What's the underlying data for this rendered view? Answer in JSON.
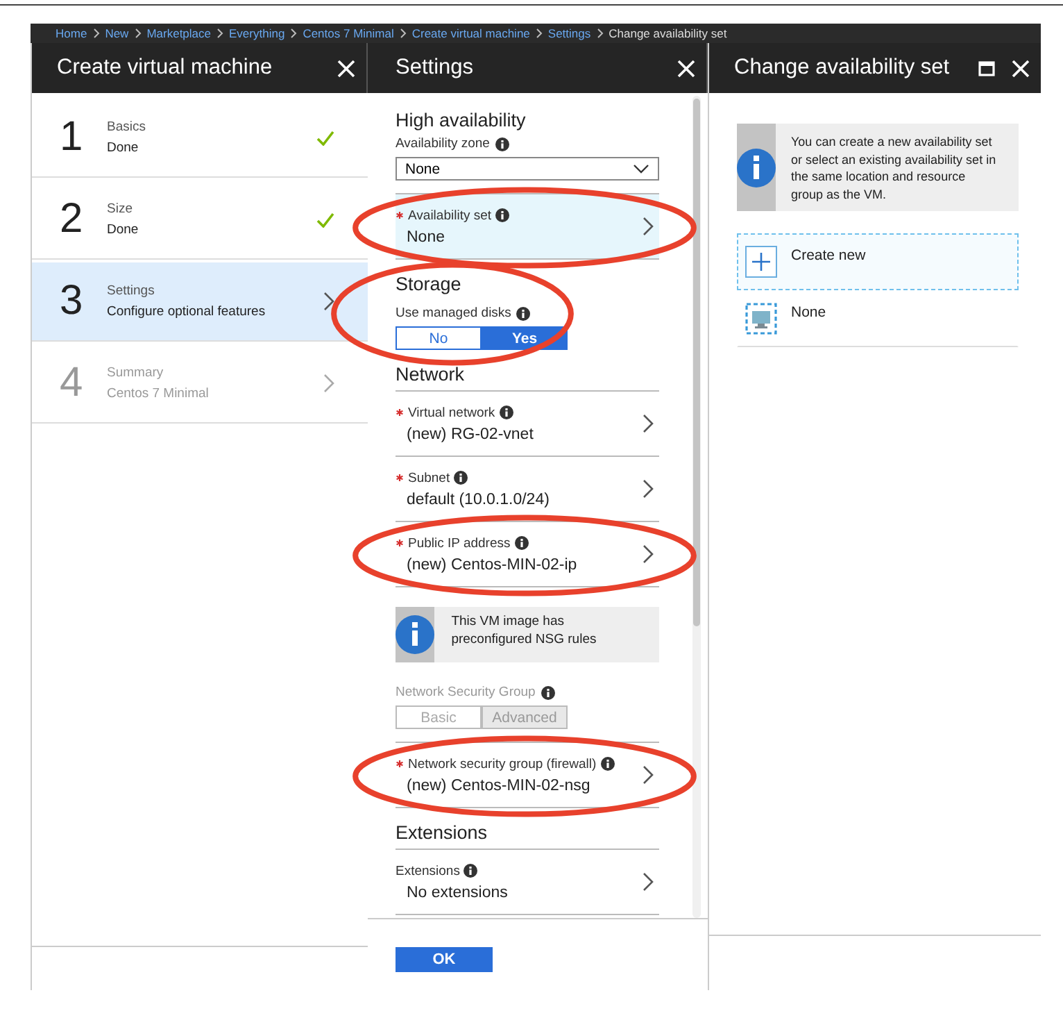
{
  "breadcrumb": [
    {
      "label": "Home",
      "link": true
    },
    {
      "label": "New",
      "link": true
    },
    {
      "label": "Marketplace",
      "link": true
    },
    {
      "label": "Everything",
      "link": true
    },
    {
      "label": "Centos 7 Minimal",
      "link": true
    },
    {
      "label": "Create virtual machine",
      "link": true
    },
    {
      "label": "Settings",
      "link": true
    },
    {
      "label": "Change availability set",
      "link": false
    }
  ],
  "create_vm": {
    "title": "Create virtual machine",
    "steps": [
      {
        "number": "1",
        "title": "Basics",
        "subtitle": "Done",
        "done": true,
        "selected": false,
        "disabled": false
      },
      {
        "number": "2",
        "title": "Size",
        "subtitle": "Done",
        "done": true,
        "selected": false,
        "disabled": false
      },
      {
        "number": "3",
        "title": "Settings",
        "subtitle": "Configure optional features",
        "done": false,
        "selected": true,
        "disabled": false
      },
      {
        "number": "4",
        "title": "Summary",
        "subtitle": "Centos 7 Minimal",
        "done": false,
        "selected": false,
        "disabled": true
      }
    ]
  },
  "settings": {
    "title": "Settings",
    "items": [
      {
        "kind": "heading",
        "text": "High availability",
        "rule": false
      },
      {
        "kind": "dropdown",
        "label": "Availability zone",
        "info": true,
        "value": "None"
      },
      {
        "kind": "picker",
        "label": "Availability set",
        "required": true,
        "info": true,
        "value": "None",
        "selected": true,
        "circled": true
      },
      {
        "kind": "heading",
        "text": "Storage",
        "rule": false
      },
      {
        "kind": "toggle",
        "label": "Use managed disks",
        "info": true,
        "disabled": false,
        "circled": true,
        "options": [
          {
            "label": "No",
            "selected": false
          },
          {
            "label": "Yes",
            "selected": true
          }
        ]
      },
      {
        "kind": "heading",
        "text": "Network",
        "rule": true
      },
      {
        "kind": "picker",
        "label": "Virtual network",
        "required": true,
        "info": true,
        "value": "(new) RG-02-vnet",
        "selected": false,
        "circled": false
      },
      {
        "kind": "picker",
        "label": "Subnet",
        "required": true,
        "info": true,
        "value": "default (10.0.1.0/24)",
        "selected": false,
        "circled": false
      },
      {
        "kind": "picker",
        "label": "Public IP address",
        "required": true,
        "info": true,
        "value": "(new) Centos-MIN-02-ip",
        "selected": false,
        "circled": true
      },
      {
        "kind": "info",
        "text": "This VM image has preconfigured NSG rules"
      },
      {
        "kind": "toggle",
        "label": "Network Security Group",
        "info": true,
        "disabled": true,
        "circled": false,
        "options": [
          {
            "label": "Basic",
            "selected": false
          },
          {
            "label": "Advanced",
            "selected": true
          }
        ]
      },
      {
        "kind": "picker",
        "label": "Network security group (firewall)",
        "required": true,
        "info": true,
        "value": "(new) Centos-MIN-02-nsg",
        "selected": false,
        "circled": true
      },
      {
        "kind": "heading",
        "text": "Extensions",
        "rule": true
      },
      {
        "kind": "picker",
        "label": "Extensions",
        "required": false,
        "info": true,
        "value": "No extensions",
        "selected": false,
        "circled": false
      }
    ],
    "ok_button": "OK"
  },
  "availability_set": {
    "title": "Change availability set",
    "info": "You can create a new availability set or select an existing availability set in the same location and resource group as the VM.",
    "options": [
      {
        "kind": "create",
        "label": "Create new",
        "selected": true
      },
      {
        "kind": "set",
        "label": "None",
        "selected": false
      }
    ]
  }
}
